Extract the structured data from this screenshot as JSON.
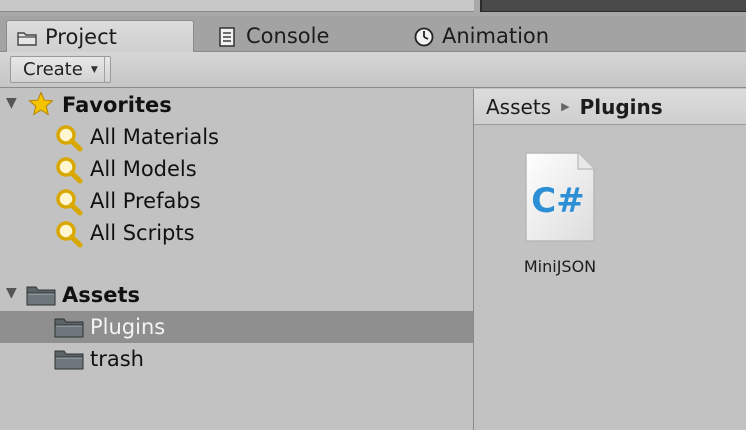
{
  "tabs": [
    {
      "label": "Project",
      "icon": "folder-icon",
      "active": true
    },
    {
      "label": "Console",
      "icon": "console-icon",
      "active": false
    },
    {
      "label": "Animation",
      "icon": "clock-icon",
      "active": false
    }
  ],
  "toolbar": {
    "create_label": "Create"
  },
  "tree": {
    "favorites": {
      "label": "Favorites",
      "items": [
        "All Materials",
        "All Models",
        "All Prefabs",
        "All Scripts"
      ]
    },
    "assets": {
      "label": "Assets",
      "items": [
        "Plugins",
        "trash"
      ],
      "selected": "Plugins"
    }
  },
  "breadcrumb": {
    "root": "Assets",
    "current": "Plugins"
  },
  "files": [
    {
      "name": "MiniJSON",
      "icon": "csharp-file-icon",
      "badge": "C#"
    }
  ],
  "colors": {
    "selection": "#8f8f8f",
    "csharp_blue": "#2c8fd6",
    "star": "#f5c400",
    "magnifier": "#e0b000"
  }
}
